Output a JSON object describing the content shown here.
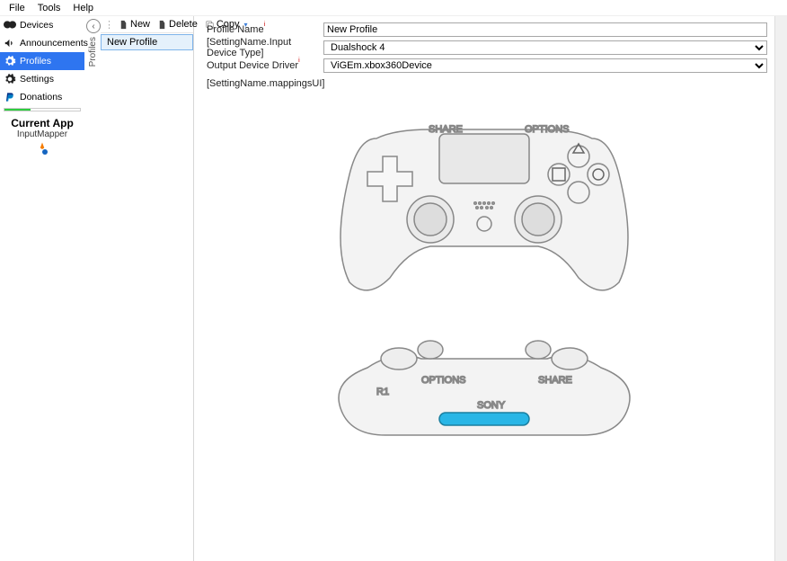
{
  "menu": {
    "file": "File",
    "tools": "Tools",
    "help": "Help"
  },
  "sidebar": {
    "items": [
      {
        "label": "Devices"
      },
      {
        "label": "Announcements"
      },
      {
        "label": "Profiles"
      },
      {
        "label": "Settings"
      },
      {
        "label": "Donations"
      }
    ],
    "current_app_title": "Current App",
    "current_app_name": "InputMapper"
  },
  "profiles_label": "Profiles",
  "toolbar": {
    "new": "New",
    "delete": "Delete",
    "copy": "Copy"
  },
  "profile_list": {
    "selected": "New Profile"
  },
  "form": {
    "profile_name_label": "Profile Name",
    "profile_name_value": "New Profile",
    "input_type_label": "[SettingName.Input Device Type]",
    "input_type_value": "Dualshock 4",
    "output_driver_label": "Output Device Driver",
    "output_driver_value": "ViGEm.xbox360Device",
    "mappings_label": "[SettingName.mappingsUI]"
  }
}
